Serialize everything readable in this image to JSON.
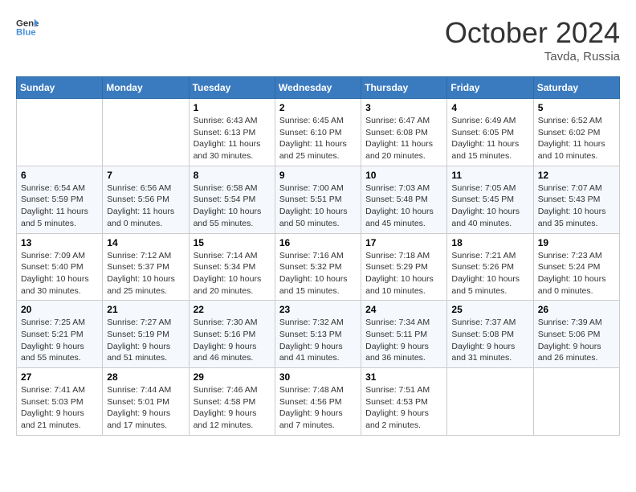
{
  "header": {
    "logo_line1": "General",
    "logo_line2": "Blue",
    "month": "October 2024",
    "location": "Tavda, Russia"
  },
  "weekdays": [
    "Sunday",
    "Monday",
    "Tuesday",
    "Wednesday",
    "Thursday",
    "Friday",
    "Saturday"
  ],
  "weeks": [
    [
      {
        "day": "",
        "sunrise": "",
        "sunset": "",
        "daylight": ""
      },
      {
        "day": "",
        "sunrise": "",
        "sunset": "",
        "daylight": ""
      },
      {
        "day": "1",
        "sunrise": "Sunrise: 6:43 AM",
        "sunset": "Sunset: 6:13 PM",
        "daylight": "Daylight: 11 hours and 30 minutes."
      },
      {
        "day": "2",
        "sunrise": "Sunrise: 6:45 AM",
        "sunset": "Sunset: 6:10 PM",
        "daylight": "Daylight: 11 hours and 25 minutes."
      },
      {
        "day": "3",
        "sunrise": "Sunrise: 6:47 AM",
        "sunset": "Sunset: 6:08 PM",
        "daylight": "Daylight: 11 hours and 20 minutes."
      },
      {
        "day": "4",
        "sunrise": "Sunrise: 6:49 AM",
        "sunset": "Sunset: 6:05 PM",
        "daylight": "Daylight: 11 hours and 15 minutes."
      },
      {
        "day": "5",
        "sunrise": "Sunrise: 6:52 AM",
        "sunset": "Sunset: 6:02 PM",
        "daylight": "Daylight: 11 hours and 10 minutes."
      }
    ],
    [
      {
        "day": "6",
        "sunrise": "Sunrise: 6:54 AM",
        "sunset": "Sunset: 5:59 PM",
        "daylight": "Daylight: 11 hours and 5 minutes."
      },
      {
        "day": "7",
        "sunrise": "Sunrise: 6:56 AM",
        "sunset": "Sunset: 5:56 PM",
        "daylight": "Daylight: 11 hours and 0 minutes."
      },
      {
        "day": "8",
        "sunrise": "Sunrise: 6:58 AM",
        "sunset": "Sunset: 5:54 PM",
        "daylight": "Daylight: 10 hours and 55 minutes."
      },
      {
        "day": "9",
        "sunrise": "Sunrise: 7:00 AM",
        "sunset": "Sunset: 5:51 PM",
        "daylight": "Daylight: 10 hours and 50 minutes."
      },
      {
        "day": "10",
        "sunrise": "Sunrise: 7:03 AM",
        "sunset": "Sunset: 5:48 PM",
        "daylight": "Daylight: 10 hours and 45 minutes."
      },
      {
        "day": "11",
        "sunrise": "Sunrise: 7:05 AM",
        "sunset": "Sunset: 5:45 PM",
        "daylight": "Daylight: 10 hours and 40 minutes."
      },
      {
        "day": "12",
        "sunrise": "Sunrise: 7:07 AM",
        "sunset": "Sunset: 5:43 PM",
        "daylight": "Daylight: 10 hours and 35 minutes."
      }
    ],
    [
      {
        "day": "13",
        "sunrise": "Sunrise: 7:09 AM",
        "sunset": "Sunset: 5:40 PM",
        "daylight": "Daylight: 10 hours and 30 minutes."
      },
      {
        "day": "14",
        "sunrise": "Sunrise: 7:12 AM",
        "sunset": "Sunset: 5:37 PM",
        "daylight": "Daylight: 10 hours and 25 minutes."
      },
      {
        "day": "15",
        "sunrise": "Sunrise: 7:14 AM",
        "sunset": "Sunset: 5:34 PM",
        "daylight": "Daylight: 10 hours and 20 minutes."
      },
      {
        "day": "16",
        "sunrise": "Sunrise: 7:16 AM",
        "sunset": "Sunset: 5:32 PM",
        "daylight": "Daylight: 10 hours and 15 minutes."
      },
      {
        "day": "17",
        "sunrise": "Sunrise: 7:18 AM",
        "sunset": "Sunset: 5:29 PM",
        "daylight": "Daylight: 10 hours and 10 minutes."
      },
      {
        "day": "18",
        "sunrise": "Sunrise: 7:21 AM",
        "sunset": "Sunset: 5:26 PM",
        "daylight": "Daylight: 10 hours and 5 minutes."
      },
      {
        "day": "19",
        "sunrise": "Sunrise: 7:23 AM",
        "sunset": "Sunset: 5:24 PM",
        "daylight": "Daylight: 10 hours and 0 minutes."
      }
    ],
    [
      {
        "day": "20",
        "sunrise": "Sunrise: 7:25 AM",
        "sunset": "Sunset: 5:21 PM",
        "daylight": "Daylight: 9 hours and 55 minutes."
      },
      {
        "day": "21",
        "sunrise": "Sunrise: 7:27 AM",
        "sunset": "Sunset: 5:19 PM",
        "daylight": "Daylight: 9 hours and 51 minutes."
      },
      {
        "day": "22",
        "sunrise": "Sunrise: 7:30 AM",
        "sunset": "Sunset: 5:16 PM",
        "daylight": "Daylight: 9 hours and 46 minutes."
      },
      {
        "day": "23",
        "sunrise": "Sunrise: 7:32 AM",
        "sunset": "Sunset: 5:13 PM",
        "daylight": "Daylight: 9 hours and 41 minutes."
      },
      {
        "day": "24",
        "sunrise": "Sunrise: 7:34 AM",
        "sunset": "Sunset: 5:11 PM",
        "daylight": "Daylight: 9 hours and 36 minutes."
      },
      {
        "day": "25",
        "sunrise": "Sunrise: 7:37 AM",
        "sunset": "Sunset: 5:08 PM",
        "daylight": "Daylight: 9 hours and 31 minutes."
      },
      {
        "day": "26",
        "sunrise": "Sunrise: 7:39 AM",
        "sunset": "Sunset: 5:06 PM",
        "daylight": "Daylight: 9 hours and 26 minutes."
      }
    ],
    [
      {
        "day": "27",
        "sunrise": "Sunrise: 7:41 AM",
        "sunset": "Sunset: 5:03 PM",
        "daylight": "Daylight: 9 hours and 21 minutes."
      },
      {
        "day": "28",
        "sunrise": "Sunrise: 7:44 AM",
        "sunset": "Sunset: 5:01 PM",
        "daylight": "Daylight: 9 hours and 17 minutes."
      },
      {
        "day": "29",
        "sunrise": "Sunrise: 7:46 AM",
        "sunset": "Sunset: 4:58 PM",
        "daylight": "Daylight: 9 hours and 12 minutes."
      },
      {
        "day": "30",
        "sunrise": "Sunrise: 7:48 AM",
        "sunset": "Sunset: 4:56 PM",
        "daylight": "Daylight: 9 hours and 7 minutes."
      },
      {
        "day": "31",
        "sunrise": "Sunrise: 7:51 AM",
        "sunset": "Sunset: 4:53 PM",
        "daylight": "Daylight: 9 hours and 2 minutes."
      },
      {
        "day": "",
        "sunrise": "",
        "sunset": "",
        "daylight": ""
      },
      {
        "day": "",
        "sunrise": "",
        "sunset": "",
        "daylight": ""
      }
    ]
  ]
}
